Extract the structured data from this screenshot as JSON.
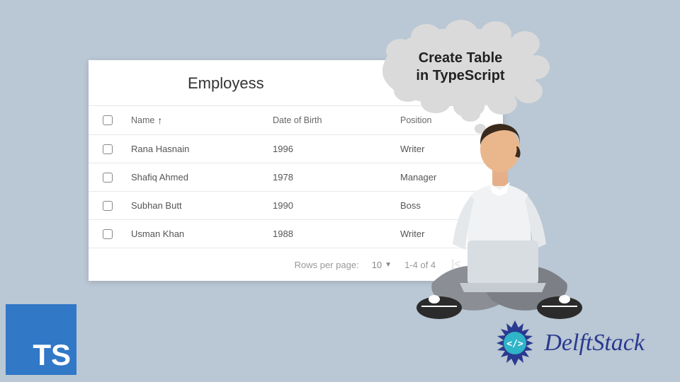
{
  "table": {
    "title": "Employess",
    "columns": {
      "name": "Name",
      "dob": "Date of Birth",
      "position": "Position"
    },
    "sort_icon": "arrow-up",
    "rows": [
      {
        "name": "Rana Hasnain",
        "dob": "1996",
        "position": "Writer"
      },
      {
        "name": "Shafiq Ahmed",
        "dob": "1978",
        "position": "Manager"
      },
      {
        "name": "Subhan Butt",
        "dob": "1990",
        "position": "Boss"
      },
      {
        "name": "Usman Khan",
        "dob": "1988",
        "position": "Writer"
      }
    ],
    "footer": {
      "rows_label": "Rows per page:",
      "rows_value": "10",
      "range": "1-4 of 4"
    }
  },
  "bubble": {
    "line1": "Create Table",
    "line2": "in TypeScript"
  },
  "ts_logo": "TS",
  "delft": "DelftStack"
}
